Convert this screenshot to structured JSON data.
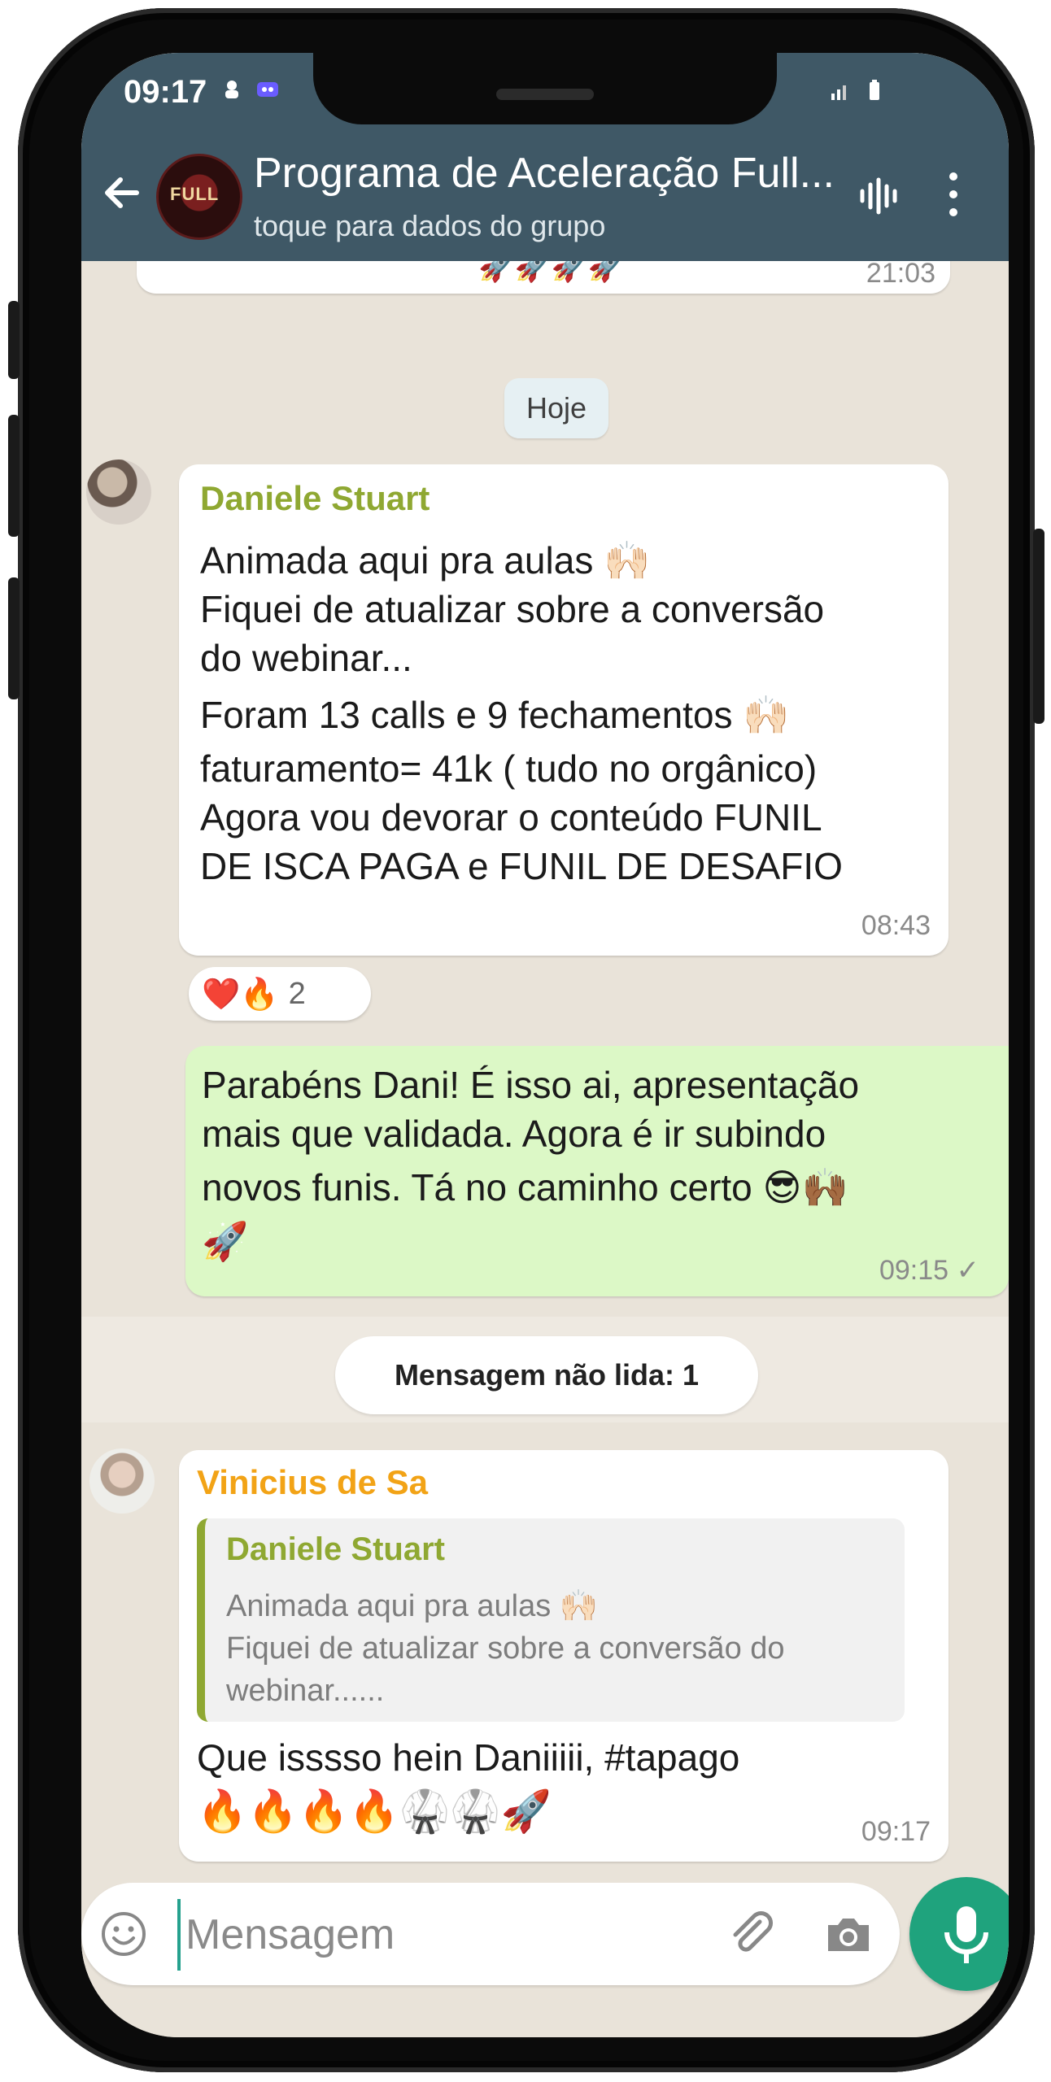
{
  "status_bar": {
    "time": "09:17"
  },
  "header": {
    "title": "Programa de Aceleração Full...",
    "subtitle": "toque para dados do grupo",
    "avatar_text": "FULL"
  },
  "chat": {
    "prev_message_time": "21:03",
    "date_divider": "Hoje",
    "messages": [
      {
        "sender": "Daniele Stuart",
        "sender_color": "#8fa832",
        "lines": [
          "Animada aqui pra aulas 🙌🏻",
          "Fiquei de atualizar sobre a conversão",
          "do webinar...",
          " Foram 13 calls e 9 fechamentos 🙌🏻",
          "faturamento= 41k ( tudo no orgânico)",
          "Agora vou devorar o conteúdo FUNIL",
          "DE ISCA PAGA e FUNIL DE DESAFIO"
        ],
        "time": "08:43",
        "reactions": {
          "emojis": "❤️🔥",
          "count": "2"
        }
      },
      {
        "sender": "",
        "outgoing": true,
        "lines": [
          "Parabéns Dani! É isso ai, apresentação",
          "mais que validada. Agora é ir subindo",
          "novos funis. Tá no caminho certo 😎🙌🏾",
          "🚀"
        ],
        "time": "09:15 ✓"
      },
      {
        "sender": "Vinicius de Sa",
        "sender_color": "#f2a316",
        "quote": {
          "name": "Daniele Stuart",
          "text_lines": [
            "Animada aqui pra aulas 🙌🏻",
            "Fiquei de atualizar sobre a conversão do",
            "webinar......"
          ]
        },
        "lines": [
          "Que isssso hein Daniiiii, #tapago",
          "🔥🔥🔥🔥🥋🥋🚀"
        ],
        "time": "09:17"
      }
    ],
    "unread_label": "Mensagem não lida: 1"
  },
  "composer": {
    "placeholder": "Mensagem"
  },
  "icons": {
    "back": "back-arrow-icon",
    "audio": "audio-call-icon",
    "menu": "more-vert-icon",
    "emoji": "emoji-icon",
    "attach": "paperclip-icon",
    "camera": "camera-icon",
    "mic": "mic-icon"
  },
  "colors": {
    "header": "#3f5866",
    "outgoing_bubble": "#dcf8c6",
    "mic_button": "#1fa37d"
  }
}
